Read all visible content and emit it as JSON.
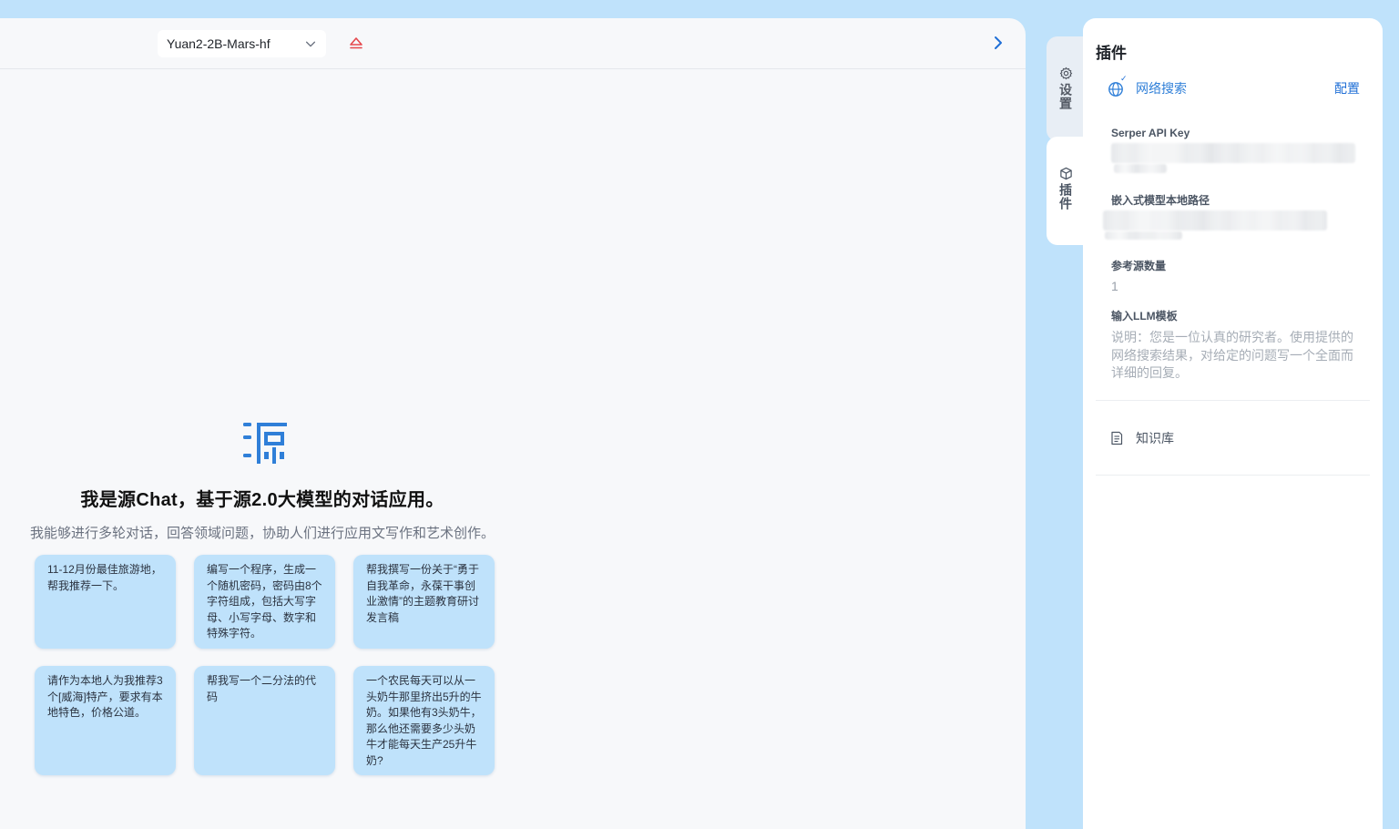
{
  "topbar": {
    "model_name": "Yuan2-2B-Mars-hf"
  },
  "welcome": {
    "headline": "我是源Chat，基于源2.0大模型的对话应用。",
    "subline": "我能够进行多轮对话，回答领域问题，协助人们进行应用文写作和艺术创作。"
  },
  "prompts": [
    "11-12月份最佳旅游地，帮我推荐一下。",
    "编写一个程序，生成一个随机密码，密码由8个字符组成，包括大写字母、小写字母、数字和特殊字符。",
    "帮我撰写一份关于“勇于自我革命，永葆干事创业激情”的主题教育研讨发言稿",
    "请作为本地人为我推荐3个[威海]特产，要求有本地特色，价格公道。",
    "帮我写一个二分法的代码",
    "一个农民每天可以从一头奶牛那里挤出5升的牛奶。如果他有3头奶牛，那么他还需要多少头奶牛才能每天生产25升牛奶?"
  ],
  "side_tabs": {
    "settings": "设置",
    "plugins": "插件"
  },
  "plugin_panel": {
    "title": "插件",
    "web_search": {
      "name": "网络搜索",
      "config": "配置",
      "serper_label": "Serper API Key",
      "embed_label": "嵌入式模型本地路径",
      "ref_count_label": "参考源数量",
      "ref_count_value": "1",
      "llm_template_label": "输入LLM模板",
      "llm_template_value": "说明：您是一位认真的研究者。使用提供的网络搜索结果，对给定的问题写一个全面而详细的回复。"
    },
    "knowledge_base": "知识库"
  },
  "colors": {
    "accent": "#1f6fd6",
    "card_bg": "#bfe2fb",
    "eject_red": "#e5484d"
  }
}
